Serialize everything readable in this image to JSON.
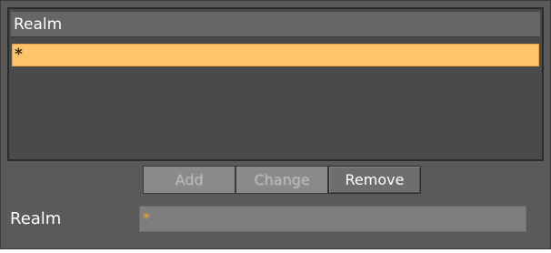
{
  "list": {
    "header": "Realm",
    "rows": [
      {
        "value": "*",
        "selected": true
      }
    ]
  },
  "buttons": {
    "add": "Add",
    "change": "Change",
    "remove": "Remove"
  },
  "form": {
    "realm_label": "Realm",
    "realm_value": "*"
  },
  "colors": {
    "panel_bg": "#5a5a5a",
    "selection": "#fdc46a",
    "field_value": "#f5a623"
  }
}
